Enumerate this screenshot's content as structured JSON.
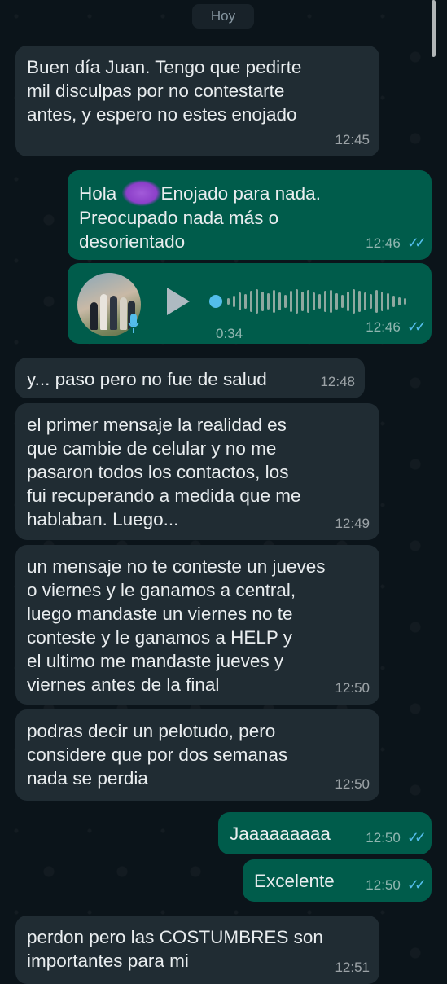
{
  "date_separator": "Hoy",
  "messages": [
    {
      "dir": "in",
      "text": "Buen día Juan. Tengo que pedirte\nmil disculpas por no contestarte\nantes, y espero no estes enojado",
      "time": "12:45"
    },
    {
      "dir": "out",
      "text_before": "Hola ",
      "text_after": "Enojado para nada.\nPreocupado nada más o\ndesorientado",
      "time": "12:46",
      "status": "read"
    },
    {
      "dir": "out",
      "type": "voice",
      "duration": "0:34",
      "time": "12:46",
      "status": "read"
    },
    {
      "dir": "in",
      "text": "y... paso pero no fue de salud",
      "time": "12:48"
    },
    {
      "dir": "in",
      "text": "el primer mensaje la realidad es\nque cambie de celular y no me\npasaron todos los contactos, los\nfui recuperando a medida que me\nhablaban. Luego...",
      "time": "12:49"
    },
    {
      "dir": "in",
      "text": "un mensaje no te conteste un jueves\no viernes y le ganamos a central,\nluego mandaste un viernes no te\nconteste y le ganamos a HELP y\nel ultimo me mandaste jueves y\nviernes antes de la final",
      "time": "12:50"
    },
    {
      "dir": "in",
      "text": "podras decir un pelotudo, pero\nconsidere que por dos semanas\nnada se perdia",
      "time": "12:50"
    },
    {
      "dir": "out",
      "text": "Jaaaaaaaaa",
      "time": "12:50",
      "status": "read"
    },
    {
      "dir": "out",
      "text": "Excelente",
      "time": "12:50",
      "status": "read"
    },
    {
      "dir": "in",
      "text": "perdon pero las COSTUMBRES son\nimportantes para mi",
      "time": "12:51"
    }
  ],
  "colors": {
    "background": "#0b141a",
    "incoming": "#202c33",
    "outgoing": "#005c4b",
    "read_ticks": "#53bdeb",
    "play": "#aebac1",
    "voice_dot": "#53bdeb"
  },
  "icons": [
    "read-ticks-icon",
    "play-icon",
    "mic-icon",
    "redaction-scribble"
  ]
}
